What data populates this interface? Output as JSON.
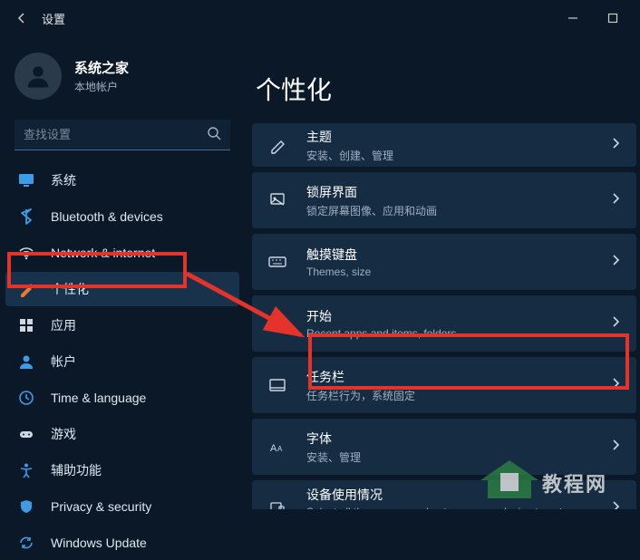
{
  "titlebar": {
    "title": "设置"
  },
  "profile": {
    "name": "系统之家",
    "sub": "本地帐户"
  },
  "search": {
    "placeholder": "查找设置"
  },
  "nav": [
    {
      "label": "系统",
      "icon": "system",
      "color": "#3c9de6"
    },
    {
      "label": "Bluetooth & devices",
      "icon": "bluetooth",
      "color": "#3c9de6"
    },
    {
      "label": "Network & internet",
      "icon": "network",
      "color": "#cfd8e2"
    },
    {
      "label": "个性化",
      "icon": "personalize",
      "color": "#e67a2e",
      "active": true
    },
    {
      "label": "应用",
      "icon": "apps",
      "color": "#cfd8e2"
    },
    {
      "label": "帐户",
      "icon": "accounts",
      "color": "#3c9de6"
    },
    {
      "label": "Time & language",
      "icon": "time",
      "color": "#3c9de6"
    },
    {
      "label": "游戏",
      "icon": "gaming",
      "color": "#cfd8e2"
    },
    {
      "label": "辅助功能",
      "icon": "accessibility",
      "color": "#3c9de6"
    },
    {
      "label": "Privacy & security",
      "icon": "privacy",
      "color": "#3c9de6"
    },
    {
      "label": "Windows Update",
      "icon": "update",
      "color": "#3c9de6"
    }
  ],
  "main": {
    "title": "个性化",
    "items": [
      {
        "title": "主题",
        "sub": "安装、创建、管理",
        "icon": "themes"
      },
      {
        "title": "锁屏界面",
        "sub": "锁定屏幕图像、应用和动画",
        "icon": "lockscreen"
      },
      {
        "title": "触摸键盘",
        "sub": "Themes, size",
        "icon": "keyboard"
      },
      {
        "title": "开始",
        "sub": "Recent apps and items, folders",
        "icon": "start"
      },
      {
        "title": "任务栏",
        "sub": "任务栏行为，系统固定",
        "icon": "taskbar",
        "highlight": true
      },
      {
        "title": "字体",
        "sub": "安装、管理",
        "icon": "fonts"
      },
      {
        "title": "设备使用情况",
        "sub": "Select all the ways you plan to use your device to get customized suggestions, options",
        "icon": "usage"
      }
    ]
  },
  "watermark": {
    "text": "教程网"
  }
}
